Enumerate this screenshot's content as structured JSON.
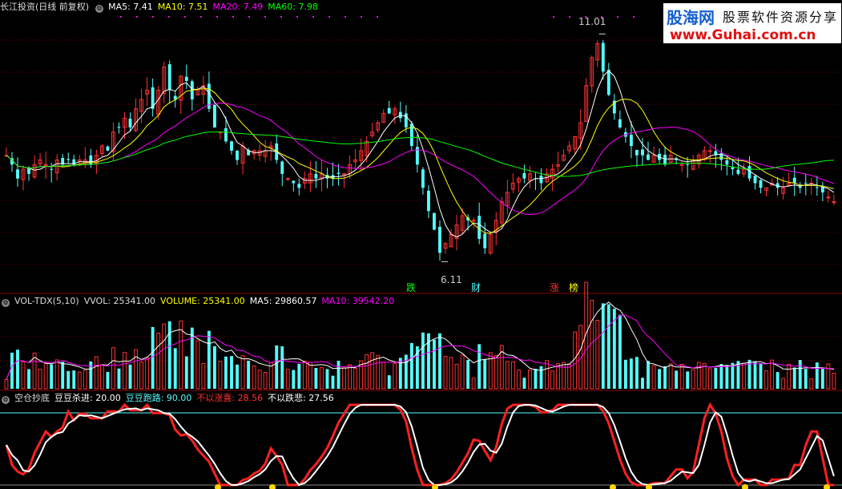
{
  "main_header": {
    "title": "长江投资(日线 前复权)",
    "ma5": "MA5: 7.41",
    "ma10": "MA10: 7.51",
    "ma20": "MA20: 7.49",
    "ma60": "MA60: 7.98"
  },
  "vol_header": {
    "name": "VOL-TDX(5,10)",
    "vvol": "VVOL: 25341.00",
    "volume": "VOLUME: 25341.00",
    "ma5": "MA5: 29860.57",
    "ma10": "MA10: 39542.20"
  },
  "ind_header": {
    "name": "空仓抄底",
    "a": "豆豆杀进: 20.00",
    "b": "豆豆跑路: 90.00",
    "c": "不以涨喜: 28.56",
    "d": "不以跌悲: 27.56"
  },
  "watermark": {
    "site": "股海网",
    "slogan": "股票软件资源分享",
    "url": "www.Guhai.com.cn"
  },
  "annotations": {
    "high": "11.01",
    "low": "6.11",
    "tag1": "跌",
    "tag2": "财",
    "tag3": "涨",
    "tag4": "榜"
  },
  "colors": {
    "up": "#ff3232",
    "down": "#54ffff",
    "ma5": "#ffffff",
    "ma10": "#ffff00",
    "ma20": "#ff00ff",
    "ma60": "#00ff00",
    "kline_red": "#ff2020"
  },
  "chart_data": [
    {
      "type": "candlestick",
      "title": "长江投资(日线 前复权)",
      "price_range": [
        5.6,
        11.5
      ],
      "high_label": 11.01,
      "low_label": 6.11,
      "closes": [
        8.4,
        8.2,
        7.9,
        8.1,
        8.0,
        8.2,
        8.3,
        8.2,
        8.1,
        8.3,
        8.2,
        8.3,
        8.2,
        8.3,
        8.3,
        8.2,
        8.4,
        8.6,
        8.5,
        8.9,
        9.0,
        9.2,
        9.0,
        9.4,
        9.6,
        9.8,
        9.4,
        9.8,
        10.3,
        9.8,
        9.6,
        10.1,
        10.0,
        9.6,
        9.8,
        9.9,
        9.4,
        9.0,
        8.9,
        8.7,
        8.5,
        8.3,
        8.6,
        8.4,
        8.5,
        8.5,
        8.5,
        8.6,
        8.3,
        8.0,
        7.9,
        7.8,
        7.7,
        7.9,
        8.0,
        7.9,
        8.0,
        7.9,
        7.9,
        8.0,
        8.0,
        8.2,
        8.3,
        8.5,
        8.7,
        8.9,
        9.1,
        9.3,
        9.3,
        9.4,
        9.2,
        9.0,
        8.6,
        8.2,
        7.7,
        7.2,
        6.8,
        6.3,
        6.5,
        6.7,
        6.9,
        7.1,
        7.0,
        7.0,
        6.6,
        6.4,
        6.7,
        7.0,
        7.4,
        7.6,
        7.8,
        7.9,
        7.9,
        8.0,
        7.9,
        7.8,
        8.0,
        8.1,
        8.2,
        8.4,
        8.6,
        8.8,
        9.1,
        9.9,
        10.5,
        10.8,
        10.2,
        9.7,
        9.3,
        9.0,
        8.8,
        8.6,
        8.4,
        8.4,
        8.3,
        8.4,
        8.3,
        8.2,
        8.4,
        8.3,
        8.2,
        8.2,
        8.3,
        8.4,
        8.5,
        8.5,
        8.4,
        8.3,
        8.2,
        8.1,
        8.0,
        8.1,
        7.9,
        7.8,
        7.7,
        7.7,
        7.8,
        7.7,
        7.7,
        7.8,
        7.8,
        7.7,
        7.8,
        7.8,
        7.7,
        7.6,
        7.5,
        7.4
      ]
    },
    {
      "type": "bar",
      "title": "VOL-TDX(5,10)",
      "series": [
        {
          "name": "VOLUME",
          "latest": 25341.0
        },
        {
          "name": "MA5",
          "latest": 29860.57
        },
        {
          "name": "MA10",
          "latest": 39542.2
        }
      ],
      "volume_range": [
        0,
        130000
      ]
    },
    {
      "type": "line",
      "title": "空仓抄底",
      "ylim": [
        0,
        100
      ],
      "levels": {
        "豆豆杀进": 20.0,
        "豆豆跑路": 90.0
      },
      "series": [
        {
          "name": "不以涨喜",
          "latest": 28.56
        },
        {
          "name": "不以跌悲",
          "latest": 27.56
        }
      ]
    }
  ]
}
